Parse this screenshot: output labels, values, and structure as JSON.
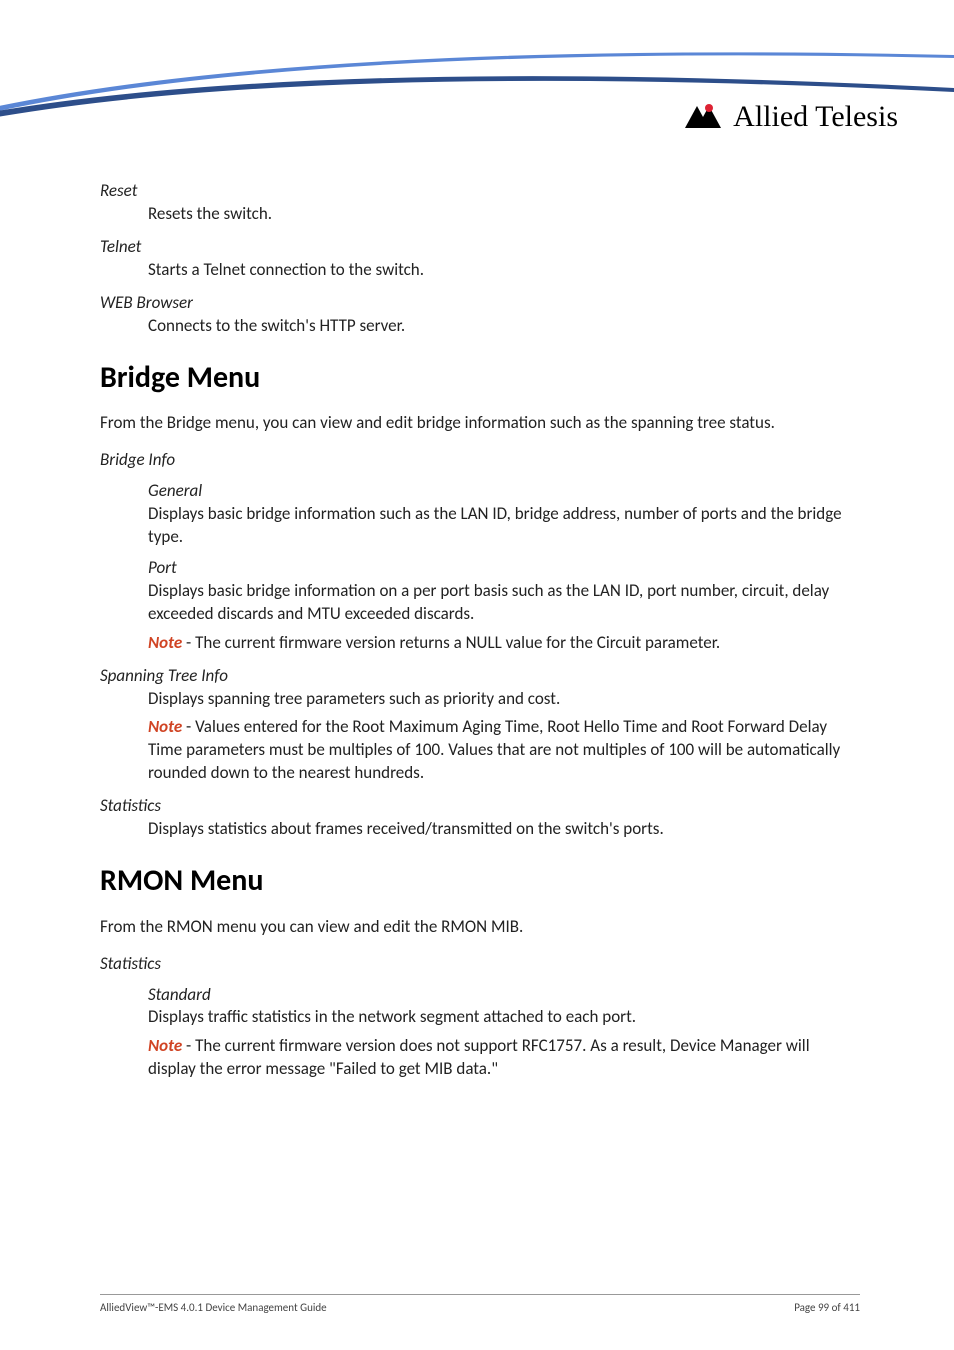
{
  "logo": {
    "brand": "Allied Telesis"
  },
  "sections": {
    "reset": {
      "title": "Reset",
      "body": "Resets the switch."
    },
    "telnet": {
      "title": "Telnet",
      "body": "Starts a Telnet connection to the switch."
    },
    "web": {
      "title": "WEB Browser",
      "body": "Connects to the switch's HTTP server."
    }
  },
  "bridge": {
    "heading": "Bridge Menu",
    "intro": "From the Bridge menu, you can view and edit bridge information such as the spanning tree status.",
    "info": {
      "title": "Bridge Info",
      "general": {
        "title": "General",
        "body": "Displays basic bridge information such as the LAN ID, bridge address, number of ports and the bridge type."
      },
      "port": {
        "title": "Port",
        "body": "Displays basic bridge information on a per port basis such as the LAN ID, port number, circuit, delay exceeded discards and MTU exceeded discards.",
        "note_label": "Note",
        "note": " - The current firmware version returns a NULL value for the Circuit parameter."
      }
    },
    "spanning": {
      "title": "Spanning Tree Info",
      "body": "Displays spanning tree parameters such as priority and cost.",
      "note_label": "Note",
      "note": " - Values entered for the Root Maximum Aging Time, Root Hello Time and Root Forward Delay Time parameters must be multiples of 100. Values that are not multiples of 100 will be automatically rounded down to the nearest hundreds."
    },
    "stats": {
      "title": "Statistics",
      "body": "Displays statistics about frames received/transmitted on the switch's ports."
    }
  },
  "rmon": {
    "heading": "RMON Menu",
    "intro": "From the RMON menu you can view and edit the RMON MIB.",
    "stats": {
      "title": "Statistics",
      "standard": {
        "title": "Standard",
        "body": "Displays traffic statistics in the network segment attached to each port.",
        "note_label": "Note",
        "note": " - The current firmware version does not support RFC1757. As a result, Device Manager will display the error message \"Failed to get MIB data.\""
      }
    }
  },
  "footer": {
    "left": "AlliedView™-EMS 4.0.1 Device Management Guide",
    "right": "Page 99 of 411"
  }
}
